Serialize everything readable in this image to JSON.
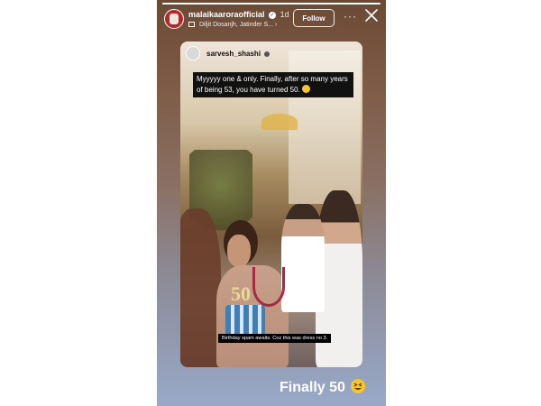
{
  "story": {
    "progress_fraction": 1.0,
    "account": {
      "username": "malaikaaroraofficial",
      "time_ago": "1d",
      "music": "Diljit Dosanjh, Jatinder S...",
      "follow_label": "Follow"
    },
    "reshare": {
      "username": "sarvesh_shashi",
      "caption": "Myyyyy one & only. Finally, after so many years of being 53, you have turned 50.",
      "caption_emoji": "tears-of-joy-emoji",
      "subtitle": "Birthday spam awaits. Coz this was dress no 3."
    },
    "overlay_text": "Finally 50",
    "overlay_emoji": "grinning-squinting-emoji"
  },
  "icons": {
    "verified": "verified-badge-icon",
    "music": "music-bars-icon",
    "more": "more-options-icon",
    "close": "close-icon"
  },
  "colors": {
    "accent": "#ffffff",
    "caption_bg": "#111111",
    "avatar_red": "#b02a2a",
    "emoji_yellow": "#f7c530"
  }
}
